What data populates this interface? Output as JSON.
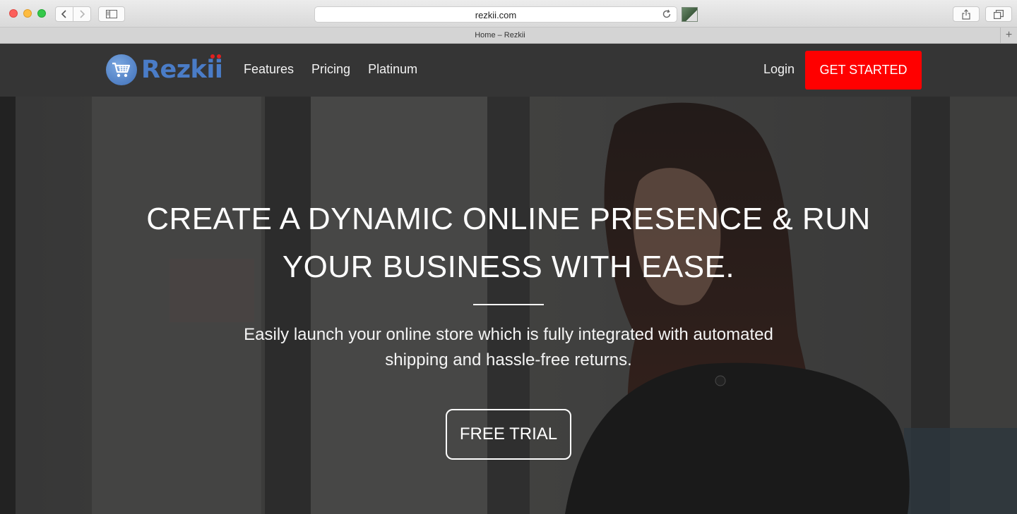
{
  "browser": {
    "url": "rezkii.com",
    "tab_title": "Home – Rezkii",
    "new_tab_symbol": "+"
  },
  "site": {
    "logo_text": "Rezkii",
    "nav": [
      {
        "label": "Features"
      },
      {
        "label": "Pricing"
      },
      {
        "label": "Platinum"
      }
    ],
    "login_label": "Login",
    "cta_label": "GET STARTED"
  },
  "hero": {
    "title_line1": "CREATE A DYNAMIC ONLINE PRESENCE & RUN",
    "title_line2": "YOUR BUSINESS WITH EASE.",
    "subtitle_line1": "Easily launch your online store which is fully integrated with automated",
    "subtitle_line2": "shipping and hassle-free returns.",
    "button_label": "FREE TRIAL"
  },
  "colors": {
    "header_bg": "#353535",
    "cta_bg": "#ff0000",
    "logo_blue": "#4a7cc7",
    "logo_dot_red": "#e02020"
  },
  "icons": {
    "back": "chevron-left-icon",
    "forward": "chevron-right-icon",
    "sidebar": "sidebar-icon",
    "reload": "reload-icon",
    "share": "share-icon",
    "tabs": "tabs-icon",
    "logo": "shopping-cart-icon"
  }
}
